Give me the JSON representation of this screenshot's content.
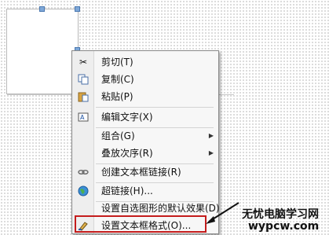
{
  "menu": {
    "items": [
      {
        "label": "剪切(T)",
        "icon": "scissors-icon"
      },
      {
        "label": "复制(C)",
        "icon": "copy-icon"
      },
      {
        "label": "粘贴(P)",
        "icon": "paste-icon"
      },
      {
        "label": "编辑文字(X)",
        "icon": "edit-text-icon"
      },
      {
        "label": "组合(G)",
        "icon": "",
        "submenu": true
      },
      {
        "label": "叠放次序(R)",
        "icon": "",
        "submenu": true
      },
      {
        "label": "创建文本框链接(R)",
        "icon": "link-icon"
      },
      {
        "label": "超链接(H)...",
        "icon": "globe-icon"
      },
      {
        "label": "设置自选图形的默认效果(D)",
        "icon": ""
      },
      {
        "label": "设置文本框格式(O)...",
        "icon": "format-icon"
      }
    ]
  },
  "watermark": {
    "line1": "无忧电脑学习网",
    "line2": "wypcw.com"
  },
  "colors": {
    "highlight": "#c41c1c"
  }
}
